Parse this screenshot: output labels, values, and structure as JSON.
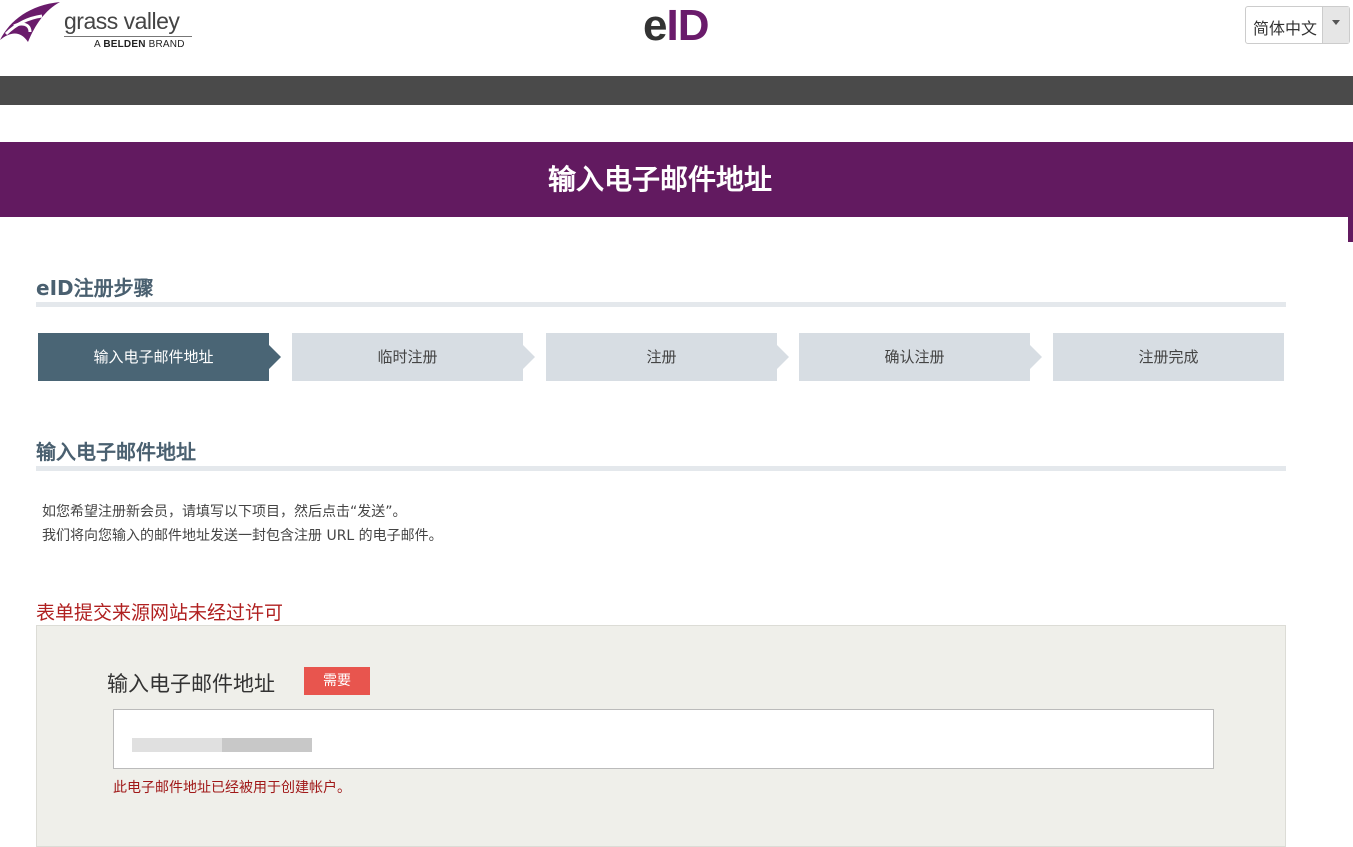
{
  "header": {
    "logo_name": "grass valley",
    "logo_sub_prefix": "A",
    "logo_sub_bold": "BELDEN",
    "logo_sub_suffix": "BRAND",
    "brand_e": "e",
    "brand_id": "ID",
    "language": "简体中文"
  },
  "page": {
    "title": "输入电子邮件地址"
  },
  "steps_section": {
    "title": "eID注册步骤",
    "steps": [
      {
        "label": "输入电子邮件地址",
        "active": true
      },
      {
        "label": "临时注册",
        "active": false
      },
      {
        "label": "注册",
        "active": false
      },
      {
        "label": "确认注册",
        "active": false
      },
      {
        "label": "注册完成",
        "active": false
      }
    ]
  },
  "form_section": {
    "title": "输入电子邮件地址",
    "intro_line1": "如您希望注册新会员，请填写以下项目，然后点击“发送”。",
    "intro_line2": "我们将向您输入的邮件地址发送一封包含注册 URL 的电子邮件。",
    "error_message": "表单提交来源网站未经过许可",
    "email_label": "输入电子邮件地址",
    "required_badge": "需要",
    "email_value": "",
    "email_error": "此电子邮件地址已经被用于创建帐户。"
  },
  "colors": {
    "brand_purple": "#621a60",
    "step_active": "#4a6575",
    "step_inactive": "#d7dde3",
    "required": "#e8554e",
    "error": "#b02020"
  }
}
